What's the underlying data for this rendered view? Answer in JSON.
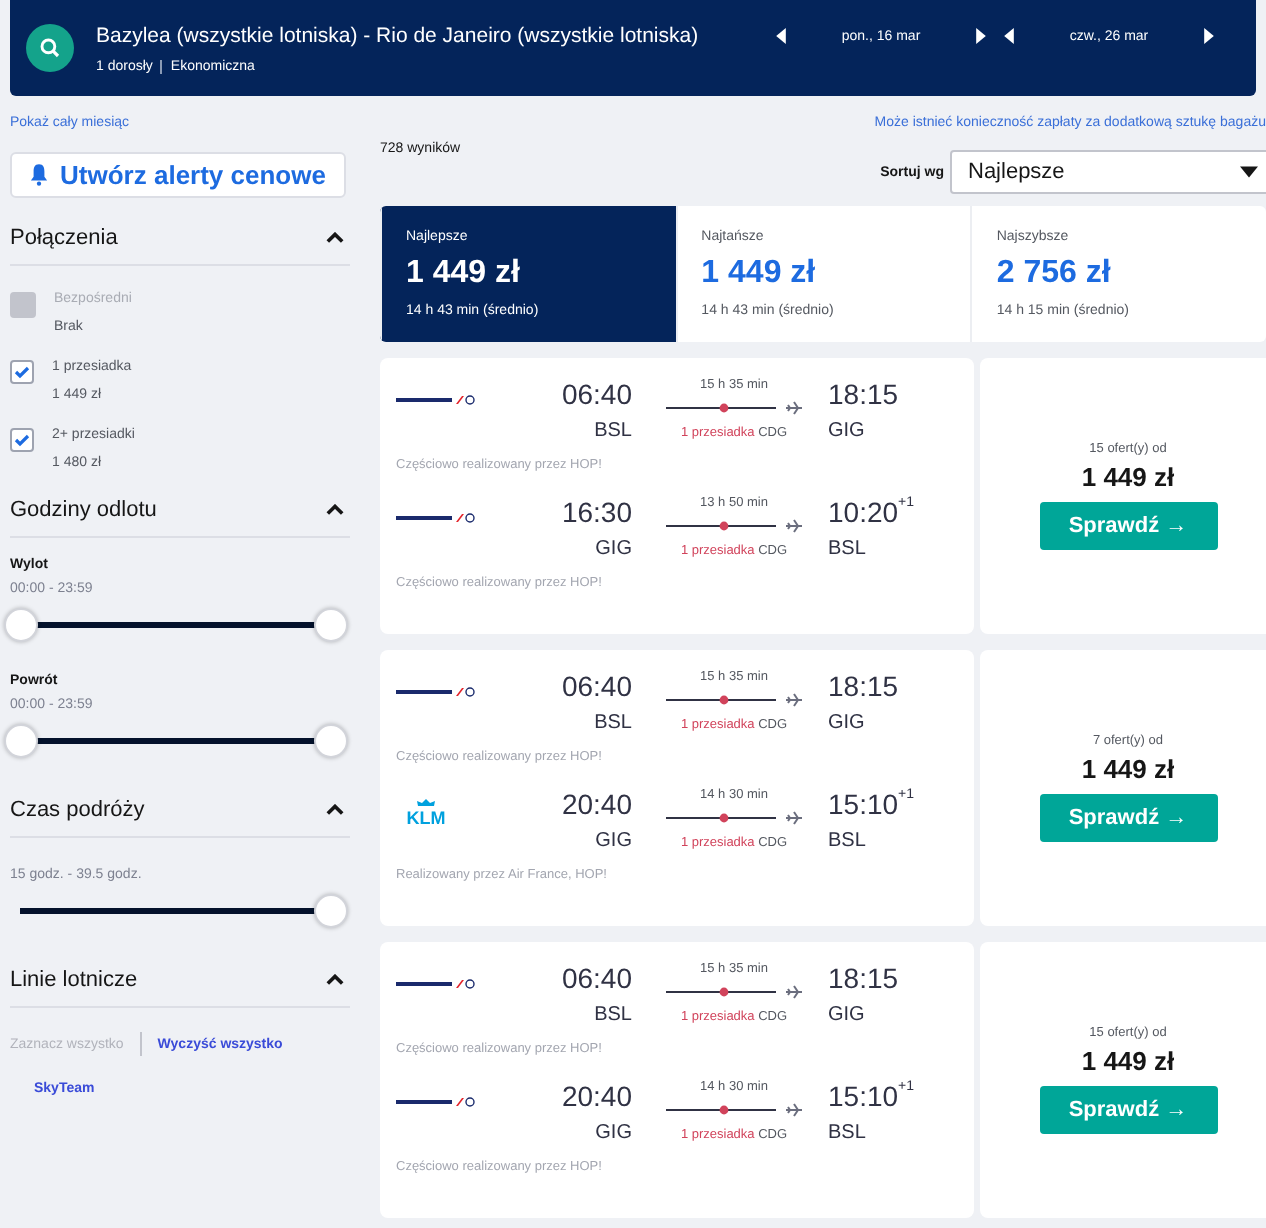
{
  "search": {
    "route": "Bazylea (wszystkie lotniska) - Rio de Janeiro (wszystkie lotniska)",
    "passengers": "1 dorosły",
    "cabin": "Ekonomiczna",
    "depart_date": "pon., 16 mar",
    "return_date": "czw., 26 mar"
  },
  "links": {
    "month": "Pokaż cały miesiąc",
    "baggage_note": "Może istnieć konieczność zapłaty za dodatkową sztukę bagażu"
  },
  "alert_button": "Utwórz alerty cenowe",
  "results_count": "728 wyników",
  "sort": {
    "label": "Sortuj wg",
    "value": "Najlepsze"
  },
  "connections": {
    "title": "Połączenia",
    "expanded": true,
    "options": [
      {
        "label": "Bezpośredni",
        "price": "Brak",
        "checked": false,
        "disabled": true
      },
      {
        "label": "1 przesiadka",
        "price": "1 449 zł",
        "checked": true,
        "disabled": false
      },
      {
        "label": "2+ przesiadki",
        "price": "1 480 zł",
        "checked": true,
        "disabled": false
      }
    ]
  },
  "departure_times": {
    "title": "Godziny odlotu",
    "expanded": true,
    "sliders": [
      {
        "label": "Wylot",
        "range": "00:00 - 23:59",
        "thumbs": [
          {
            "level": 0
          },
          {
            "level": 1
          }
        ]
      },
      {
        "label": "Powrót",
        "range": "00:00 - 23:59",
        "thumbs": [
          {
            "level": 0
          },
          {
            "level": 1
          }
        ]
      }
    ]
  },
  "travel_time": {
    "title": "Czas podróży",
    "expanded": true,
    "range": "15 godz. - 39.5 godz.",
    "thumbs": [
      {
        "level": 1
      }
    ]
  },
  "airlines": {
    "title": "Linie lotnicze",
    "expanded": true,
    "select_all": "Zaznacz wszystko",
    "select_all_disabled": true,
    "clear_all": "Wyczyść wszystko",
    "alliance": "SkyTeam"
  },
  "summary_tabs": [
    {
      "label": "Najlepsze",
      "price": "1 449 zł",
      "duration": "14 h 43 min (średnio)",
      "selected": true
    },
    {
      "label": "Najtańsze",
      "price": "1 449 zł",
      "duration": "14 h 43 min (średnio)",
      "selected": false
    },
    {
      "label": "Najszybsze",
      "price": "2 756 zł",
      "duration": "14 h 15 min (średnio)",
      "selected": false
    }
  ],
  "results": [
    {
      "legs": [
        {
          "kind": "airfrance",
          "depart": "06:40",
          "from": "BSL",
          "duration": "15 h 35 min",
          "stops": "1 przesiadka",
          "via": "CDG",
          "arrive": "18:15",
          "to": "GIG",
          "operated": "Częściowo realizowany przez HOP!"
        },
        {
          "kind": "airfrance",
          "depart": "16:30",
          "from": "GIG",
          "duration": "13 h 50 min",
          "stops": "1 przesiadka",
          "via": "CDG",
          "arrive": "10:20",
          "arrive_offset": "+1",
          "to": "BSL",
          "operated": "Częściowo realizowany przez HOP!"
        }
      ],
      "offers": "15 ofert(y) od",
      "price": "1 449 zł",
      "button": "Sprawdź →"
    },
    {
      "legs": [
        {
          "kind": "airfrance",
          "depart": "06:40",
          "from": "BSL",
          "duration": "15 h 35 min",
          "stops": "1 przesiadka",
          "via": "CDG",
          "arrive": "18:15",
          "to": "GIG",
          "operated": "Częściowo realizowany przez HOP!"
        },
        {
          "kind": "klm",
          "logo_text": "KLM",
          "depart": "20:40",
          "from": "GIG",
          "duration": "14 h 30 min",
          "stops": "1 przesiadka",
          "via": "CDG",
          "arrive": "15:10",
          "arrive_offset": "+1",
          "to": "BSL",
          "operated": "Realizowany przez Air France, HOP!"
        }
      ],
      "offers": "7 ofert(y) od",
      "price": "1 449 zł",
      "button": "Sprawdź →"
    },
    {
      "legs": [
        {
          "kind": "airfrance",
          "depart": "06:40",
          "from": "BSL",
          "duration": "15 h 35 min",
          "stops": "1 przesiadka",
          "via": "CDG",
          "arrive": "18:15",
          "to": "GIG",
          "operated": "Częściowo realizowany przez HOP!"
        },
        {
          "kind": "airfrance",
          "depart": "20:40",
          "from": "GIG",
          "duration": "14 h 30 min",
          "stops": "1 przesiadka",
          "via": "CDG",
          "arrive": "15:10",
          "arrive_offset": "+1",
          "to": "BSL",
          "operated": "Częściowo realizowany przez HOP!"
        }
      ],
      "offers": "15 ofert(y) od",
      "price": "1 449 zł",
      "button": "Sprawdź →"
    }
  ]
}
